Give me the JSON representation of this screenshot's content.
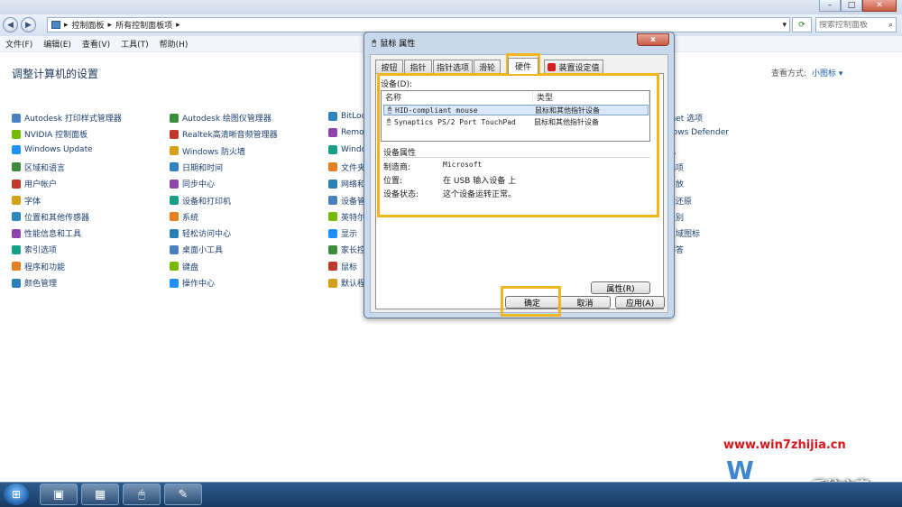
{
  "window": {
    "breadcrumb": [
      "控制面板",
      "所有控制面板项"
    ],
    "search_placeholder": "搜索控制面板"
  },
  "menubar": [
    "文件(F)",
    "编辑(E)",
    "查看(V)",
    "工具(T)",
    "帮助(H)"
  ],
  "page_title": "调整计算机的设置",
  "view_by": {
    "label": "查看方式:",
    "value": "小图标"
  },
  "control_panel": {
    "col1": [
      "Autodesk 打印样式管理器",
      "NVIDIA 控制面板",
      "Windows Update",
      "区域和语言",
      "用户帐户",
      "字体",
      "位置和其他传感器",
      "性能信息和工具",
      "索引选项",
      "程序和功能",
      "颜色管理"
    ],
    "col2": [
      "Autodesk 绘图仪管理器",
      "Realtek高清晰音频管理器",
      "Windows 防火墙",
      "日期和时间",
      "同步中心",
      "设备和打印机",
      "系统",
      "轻松访问中心",
      "桌面小工具",
      "键盘",
      "操作中心"
    ],
    "col3": [
      "BitLoc",
      "Remo",
      "Windo",
      "文件夹",
      "网络和",
      "设备管",
      "英特尔",
      "显示",
      "家长控",
      "鼠标",
      "默认程"
    ],
    "col4": [
      "rnet 选项",
      "dows Defender",
      "化",
      "选项",
      "播放",
      "和还原",
      "识别",
      "区域图标",
      "解答"
    ]
  },
  "dialog": {
    "title": "鼠标 属性",
    "close": "x",
    "tabs": [
      "按钮",
      "指针",
      "指针选项",
      "滑轮",
      "硬件",
      "装置设定值"
    ],
    "devices_label": "设备(D):",
    "columns": [
      "名称",
      "类型"
    ],
    "devices": [
      {
        "name": "HID-compliant mouse",
        "type": "鼠标和其他指针设备"
      },
      {
        "name": "Synaptics PS/2 Port TouchPad",
        "type": "鼠标和其他指针设备"
      }
    ],
    "props_title": "设备属性",
    "props": [
      {
        "label": "制造商:",
        "value": "Microsoft"
      },
      {
        "label": "位置:",
        "value": "在 USB 输入设备 上"
      },
      {
        "label": "设备状态:",
        "value": "这个设备运转正常。"
      }
    ],
    "properties_button": "属性(R)",
    "ok": "确定",
    "cancel": "取消",
    "apply": "应用(A)"
  },
  "watermark": {
    "url": "www.win7zhijia.cn",
    "brand": "系统之家"
  },
  "colors": {
    "highlight": "#f0b61e",
    "link": "#1c3f6e",
    "title": "#1e395b"
  }
}
